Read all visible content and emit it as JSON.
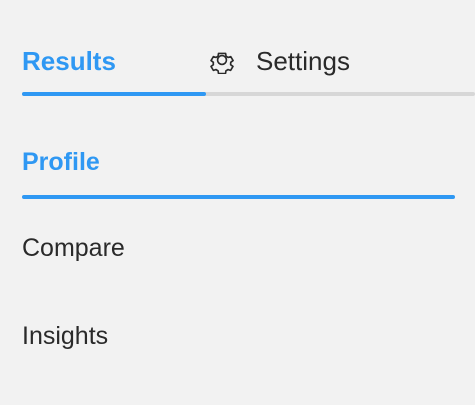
{
  "tabs": {
    "items": [
      {
        "label": "Results",
        "active": true
      },
      {
        "label": "Settings",
        "active": false,
        "icon": "gear-icon"
      }
    ]
  },
  "nav": {
    "items": [
      {
        "label": "Profile",
        "active": true
      },
      {
        "label": "Compare",
        "active": false
      },
      {
        "label": "Insights",
        "active": false
      }
    ]
  },
  "colors": {
    "accent": "#2f98f3",
    "text": "#2a2a2a",
    "background": "#f2f2f2",
    "track": "#d7d7d7"
  }
}
